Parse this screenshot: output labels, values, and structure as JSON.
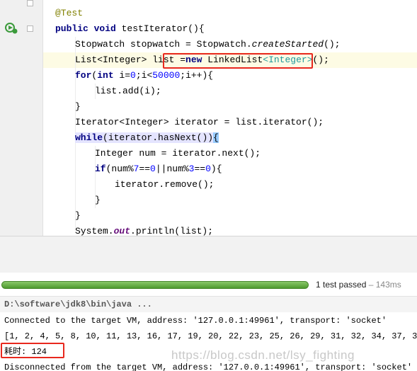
{
  "editor": {
    "lines": {
      "annotation": "@Test",
      "method_decl": {
        "kw": "public void",
        "rest": " testIterator(){"
      },
      "stopwatch": {
        "pre": "Stopwatch stopwatch = Stopwatch.",
        "method": "createStarted",
        "post": "();"
      },
      "list_decl": {
        "pre": "List<Integer> list ",
        "eq": "=",
        "kw": "new",
        "post": " LinkedList",
        "generic": "<Integer>",
        "end": "();"
      },
      "for_loop": {
        "kw": "for",
        "a": "(",
        "kw2": "int",
        "b": " i=",
        "n0": "0",
        "c": ";i<",
        "n1": "50000",
        "d": ";i++){"
      },
      "list_add": "list.add(i);",
      "close1": "}",
      "iterator_decl": "Iterator<Integer> iterator = list.iterator();",
      "while_loop": {
        "kw": "while",
        "cond": "(iterator.hasNext())",
        "brace": "{"
      },
      "next_call": "Integer num = iterator.next();",
      "if_cond": {
        "kw": "if",
        "a": "(num%",
        "n7": "7",
        "b": "==",
        "n0": "0",
        "c": "||num%",
        "n3": "3",
        "d": "==",
        "n0b": "0",
        "e": "){"
      },
      "remove_call": "iterator.remove();",
      "close2": "}",
      "close3": "}",
      "println": {
        "pre": "System.",
        "field": "out",
        "post": ".println(list);"
      }
    }
  },
  "run_panel": {
    "status_text": "1 test passed",
    "duration": "143ms",
    "progress": 1.0,
    "console": {
      "command": "D:\\software\\jdk8\\bin\\java ...",
      "connected": "Connected to the target VM, address: '127.0.0.1:49961', transport: 'socket'",
      "output_list": "[1, 2, 4, 5, 8, 10, 11, 13, 16, 17, 19, 20, 22, 23, 25, 26, 29, 31, 32, 34, 37, 38,",
      "elapsed": "耗时: 124",
      "disconnected": "Disconnected from the target VM, address: '127.0.0.1:49961', transport: 'socket'"
    },
    "watermark": "https://blog.csdn.net/lsy_fighting"
  },
  "colors": {
    "keyword": "#000080",
    "number": "#0000ff",
    "annotation": "#808000",
    "highlight_box": "#e8281e",
    "progress_green": "#5fa33e"
  }
}
